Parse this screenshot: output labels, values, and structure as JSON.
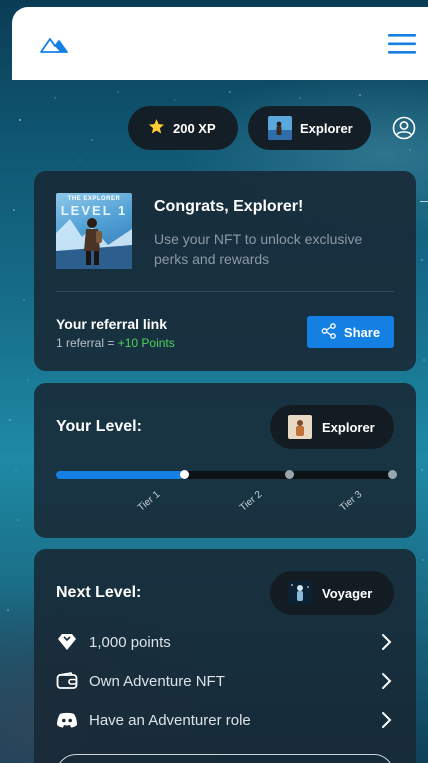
{
  "header": {
    "logo_icon": "mountain-logo-icon",
    "menu_icon": "hamburger-menu-icon"
  },
  "badges": {
    "xp_label": "200 XP",
    "xp_icon": "star-icon",
    "role_label": "Explorer",
    "profile_icon": "user-circle-icon"
  },
  "nft_card": {
    "thumb_caption": "THE EXPLORER",
    "thumb_level": "LEVEL 1",
    "title": "Congrats, Explorer!",
    "description": "Use your NFT to unlock exclusive perks and rewards",
    "referral_title": "Your referral link",
    "referral_count": "1 referral = ",
    "referral_reward": "+10 Points",
    "share_label": "Share"
  },
  "level_card": {
    "label": "Your Level:",
    "current_level": "Explorer",
    "progress": 0.38,
    "tiers": [
      "Tier 1",
      "Tier 2",
      "Tier 3"
    ]
  },
  "next_level_card": {
    "label": "Next Level:",
    "next_level": "Voyager",
    "requirements": [
      {
        "text": "1,000 points",
        "icon": "points-gem-icon"
      },
      {
        "text": "Own Adventure NFT",
        "icon": "wallet-icon"
      },
      {
        "text": "Have an Adventurer role",
        "icon": "discord-icon"
      }
    ]
  },
  "colors": {
    "accent": "#1480e4",
    "success": "#4fd25b",
    "pill_bg": "#141e27",
    "star": "#ffcc33"
  }
}
